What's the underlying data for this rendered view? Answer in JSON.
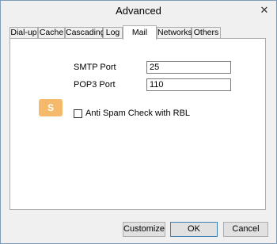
{
  "window": {
    "title": "Advanced",
    "close_glyph": "✕"
  },
  "tabs": [
    {
      "label": "Dial-up",
      "active": false
    },
    {
      "label": "Cache",
      "active": false
    },
    {
      "label": "Cascading",
      "active": false
    },
    {
      "label": "Log",
      "active": false
    },
    {
      "label": "Mail",
      "active": true
    },
    {
      "label": "Networks",
      "active": false
    },
    {
      "label": "Others",
      "active": false
    }
  ],
  "mail": {
    "smtp_label": "SMTP Port",
    "smtp_value": "25",
    "pop3_label": "POP3 Port",
    "pop3_value": "110",
    "antispam_label": "Anti Spam Check with RBL",
    "antispam_checked": false
  },
  "buttons": {
    "customize": "Customize",
    "ok": "OK",
    "cancel": "Cancel"
  }
}
